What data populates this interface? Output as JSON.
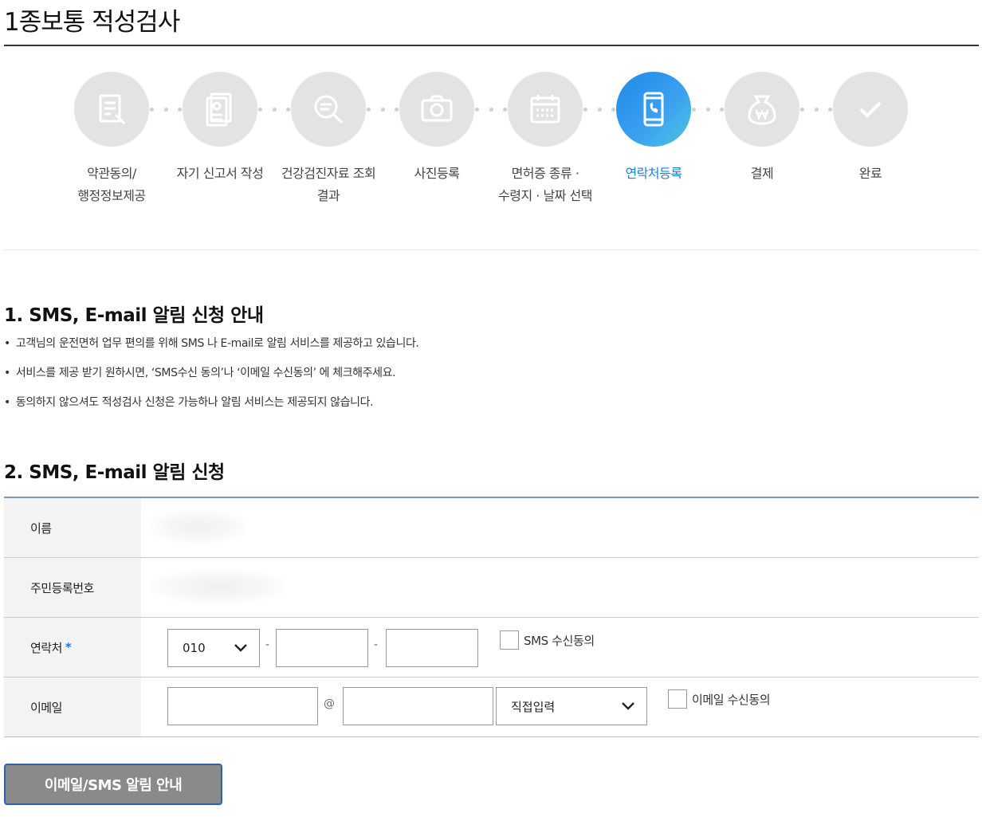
{
  "page": {
    "title": "1종보통 적성검사"
  },
  "steps": [
    {
      "label": "약관동의/\n행정정보제공",
      "icon": "document-pen-icon",
      "active": false
    },
    {
      "label": "자기 신고서 작성",
      "icon": "id-card-document-icon",
      "active": false
    },
    {
      "label": "건강검진자료 조회\n결과",
      "icon": "search-document-icon",
      "active": false
    },
    {
      "label": "사진등록",
      "icon": "camera-icon",
      "active": false
    },
    {
      "label": "면허증 종류 ·\n수령지 · 날짜 선택",
      "icon": "calendar-icon",
      "active": false
    },
    {
      "label": "연락처등록",
      "icon": "mobile-phone-icon",
      "active": true
    },
    {
      "label": "결제",
      "icon": "won-pouch-icon",
      "active": false
    },
    {
      "label": "완료",
      "icon": "check-icon",
      "active": false
    }
  ],
  "colors": {
    "accent": "#1e7fe0",
    "inactive_step": "#e3e3e3",
    "table_border": "#7d95c2",
    "button_bg": "#8a8a8a",
    "button_border": "#2f5fb0"
  },
  "section1": {
    "title": "1. SMS, E-mail 알림 신청 안내",
    "bullets": [
      "고객님의 운전면허 업무 편의를 위해 SMS 나 E-mail로 알림 서비스를 제공하고 있습니다.",
      "서비스를 제공 받기 원하시면, ‘SMS수신 동의’나 ‘이메일 수신동의’ 에 체크해주세요.",
      "동의하지 않으셔도 적성검사 신청은 가능하나 알림 서비스는 제공되지 않습니다."
    ]
  },
  "section2": {
    "title": "2. SMS, E-mail 알림 신청",
    "rows": {
      "name_label": "이름",
      "rrn_label": "주민등록번호",
      "phone_label": "연락처",
      "phone_required_mark": "*",
      "phone_prefix": "010",
      "phone_dash": "-",
      "phone_middle": "",
      "phone_last": "",
      "sms_consent_label": "SMS 수신동의",
      "email_label": "이메일",
      "email_local": "",
      "email_at": "@",
      "email_domain": "",
      "email_domain_select": "직접입력",
      "email_consent_label": "이메일 수신동의"
    }
  },
  "actions": {
    "notice_button": "이메일/SMS 알림 안내"
  }
}
